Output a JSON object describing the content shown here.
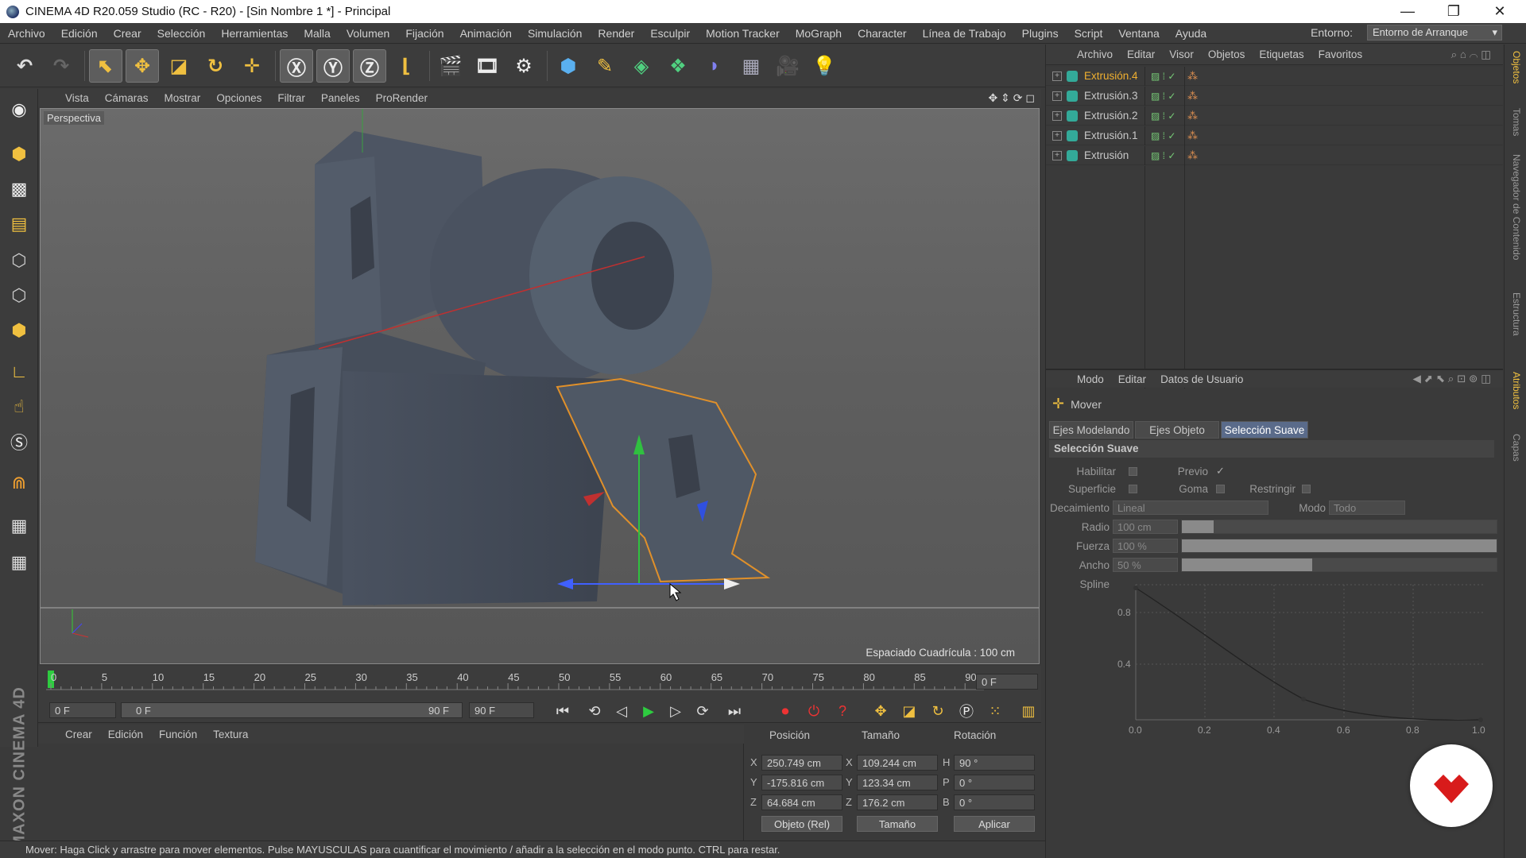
{
  "window": {
    "title": "CINEMA 4D R20.059 Studio (RC - R20) - [Sin Nombre 1 *] - Principal"
  },
  "menu": [
    "Archivo",
    "Edición",
    "Crear",
    "Selección",
    "Herramientas",
    "Malla",
    "Volumen",
    "Fijación",
    "Animación",
    "Simulación",
    "Render",
    "Esculpir",
    "Motion Tracker",
    "MoGraph",
    "Character",
    "Línea de Trabajo",
    "Plugins",
    "Script",
    "Ventana",
    "Ayuda"
  ],
  "env": {
    "label": "Entorno:",
    "value": "Entorno de Arranque"
  },
  "viewport": {
    "menu": [
      "Vista",
      "Cámaras",
      "Mostrar",
      "Opciones",
      "Filtrar",
      "Paneles",
      "ProRender"
    ],
    "label": "Perspectiva",
    "grid": "Espaciado Cuadrícula : 100 cm"
  },
  "timeline": {
    "ticks": [
      "0",
      "5",
      "10",
      "15",
      "20",
      "25",
      "30",
      "35",
      "40",
      "45",
      "50",
      "55",
      "60",
      "65",
      "70",
      "75",
      "80",
      "85",
      "90"
    ],
    "current": "0 F",
    "start": "0 F",
    "range_start": "0 F",
    "range_end": "90 F",
    "end": "90 F"
  },
  "materials": {
    "menu": [
      "Crear",
      "Edición",
      "Función",
      "Textura"
    ]
  },
  "brand": "MAXON CINEMA 4D",
  "coords": {
    "headers": [
      "Posición",
      "Tamaño",
      "Rotación"
    ],
    "pos": [
      {
        "axis": "X",
        "value": "250.749 cm"
      },
      {
        "axis": "Y",
        "value": "-175.816 cm"
      },
      {
        "axis": "Z",
        "value": "64.684 cm"
      }
    ],
    "size": [
      {
        "axis": "X",
        "value": "109.244 cm"
      },
      {
        "axis": "Y",
        "value": "123.34 cm"
      },
      {
        "axis": "Z",
        "value": "176.2 cm"
      }
    ],
    "rot": [
      {
        "axis": "H",
        "value": "90 °"
      },
      {
        "axis": "P",
        "value": "0 °"
      },
      {
        "axis": "B",
        "value": "0 °"
      }
    ],
    "mode": "Objeto (Rel)",
    "sizemode": "Tamaño",
    "apply": "Aplicar"
  },
  "status": "Mover: Haga Click y arrastre para mover elementos. Pulse MAYUSCULAS para cuantificar el movimiento / añadir a la selección en el modo punto. CTRL para restar.",
  "objects": {
    "menu": [
      "Archivo",
      "Editar",
      "Visor",
      "Objetos",
      "Etiquetas",
      "Favoritos"
    ],
    "items": [
      "Extrusión.4",
      "Extrusión.3",
      "Extrusión.2",
      "Extrusión.1",
      "Extrusión"
    ]
  },
  "attributes": {
    "menu": [
      "Modo",
      "Editar",
      "Datos de Usuario"
    ],
    "tool": "Mover",
    "tabs": [
      "Ejes Modelando",
      "Ejes Objeto",
      "Selección Suave"
    ],
    "section": "Selección Suave",
    "habilitar": "Habilitar",
    "previo": "Previo",
    "superficie": "Superficie",
    "goma": "Goma",
    "restringir": "Restringir",
    "decaimiento_label": "Decaimiento",
    "decaimiento": "Lineal",
    "modo_label": "Modo",
    "modo": "Todo",
    "radio_label": "Radio",
    "radio": "100 cm",
    "fuerza_label": "Fuerza",
    "fuerza": "100 %",
    "fuerza_level": 1.0,
    "ancho_label": "Ancho",
    "ancho": "50 %",
    "ancho_level": 0.5,
    "spline_label": "Spline",
    "y_ticks": [
      "0.8",
      "0.4"
    ],
    "x_ticks": [
      "0.0",
      "0.2",
      "0.4",
      "0.6",
      "0.8",
      "1.0"
    ]
  },
  "side_tabs": [
    "Objetos",
    "Tomas",
    "Navegador de Contenido",
    "Estructura",
    "Atributos",
    "Capas"
  ]
}
